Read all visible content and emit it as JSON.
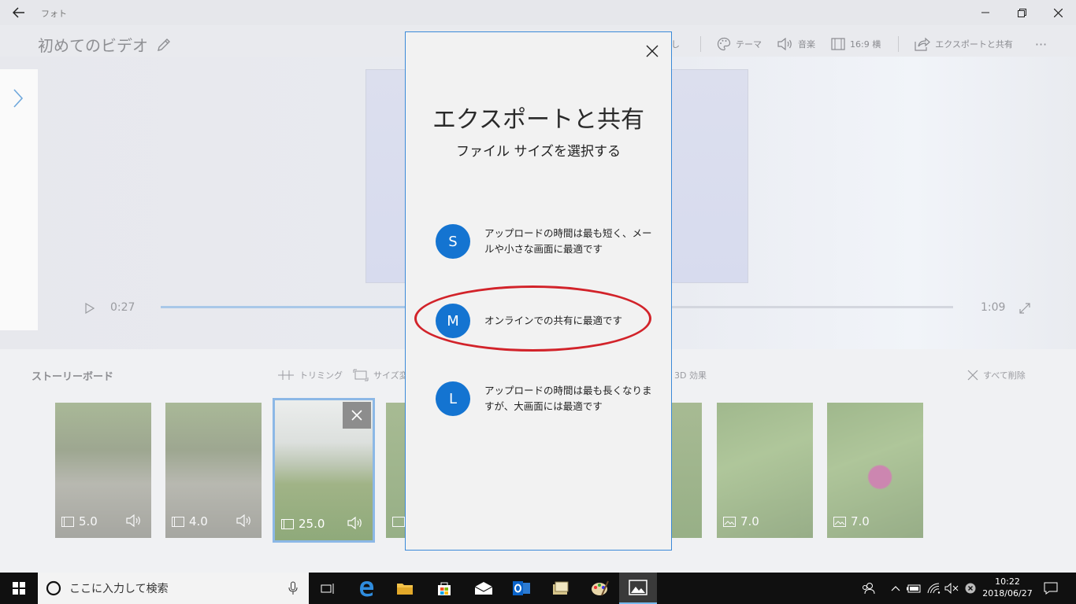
{
  "app": {
    "name": "フォト"
  },
  "project": {
    "title": "初めてのビデオ"
  },
  "toolbar": {
    "partial": "し",
    "theme": "テーマ",
    "music": "音楽",
    "aspect": "16:9 横",
    "export": "エクスポートと共有",
    "more": "···"
  },
  "player": {
    "current_time": "0:27",
    "total_time": "1:09",
    "progress": 0.39
  },
  "storyboard": {
    "title": "ストーリーボード",
    "trim": "トリミング",
    "resize": "サイズ変",
    "effects3d": "3D 効果",
    "delete_all": "すべて削除",
    "clips": [
      {
        "duration": "5.0",
        "kind": "video"
      },
      {
        "duration": "4.0",
        "kind": "video"
      },
      {
        "duration": "25.0",
        "kind": "video",
        "selected": true
      },
      {
        "duration": "",
        "kind": "photo"
      },
      {
        "duration": "",
        "kind": "photo"
      },
      {
        "duration": "7.0",
        "kind": "photo"
      },
      {
        "duration": "7.0",
        "kind": "photo"
      }
    ]
  },
  "dialog": {
    "title": "エクスポートと共有",
    "subtitle": "ファイル サイズを選択する",
    "options": [
      {
        "letter": "S",
        "text": "アップロードの時間は最も短く、メールや小さな画面に最適です"
      },
      {
        "letter": "M",
        "text": "オンラインでの共有に最適です"
      },
      {
        "letter": "L",
        "text": "アップロードの時間は最も長くなりますが、大画面には最適です"
      }
    ]
  },
  "taskbar": {
    "search_placeholder": "ここに入力して検索",
    "time": "10:22",
    "date": "2018/06/27"
  },
  "colors": {
    "accent": "#1474d1",
    "annotation": "#d2232a"
  }
}
